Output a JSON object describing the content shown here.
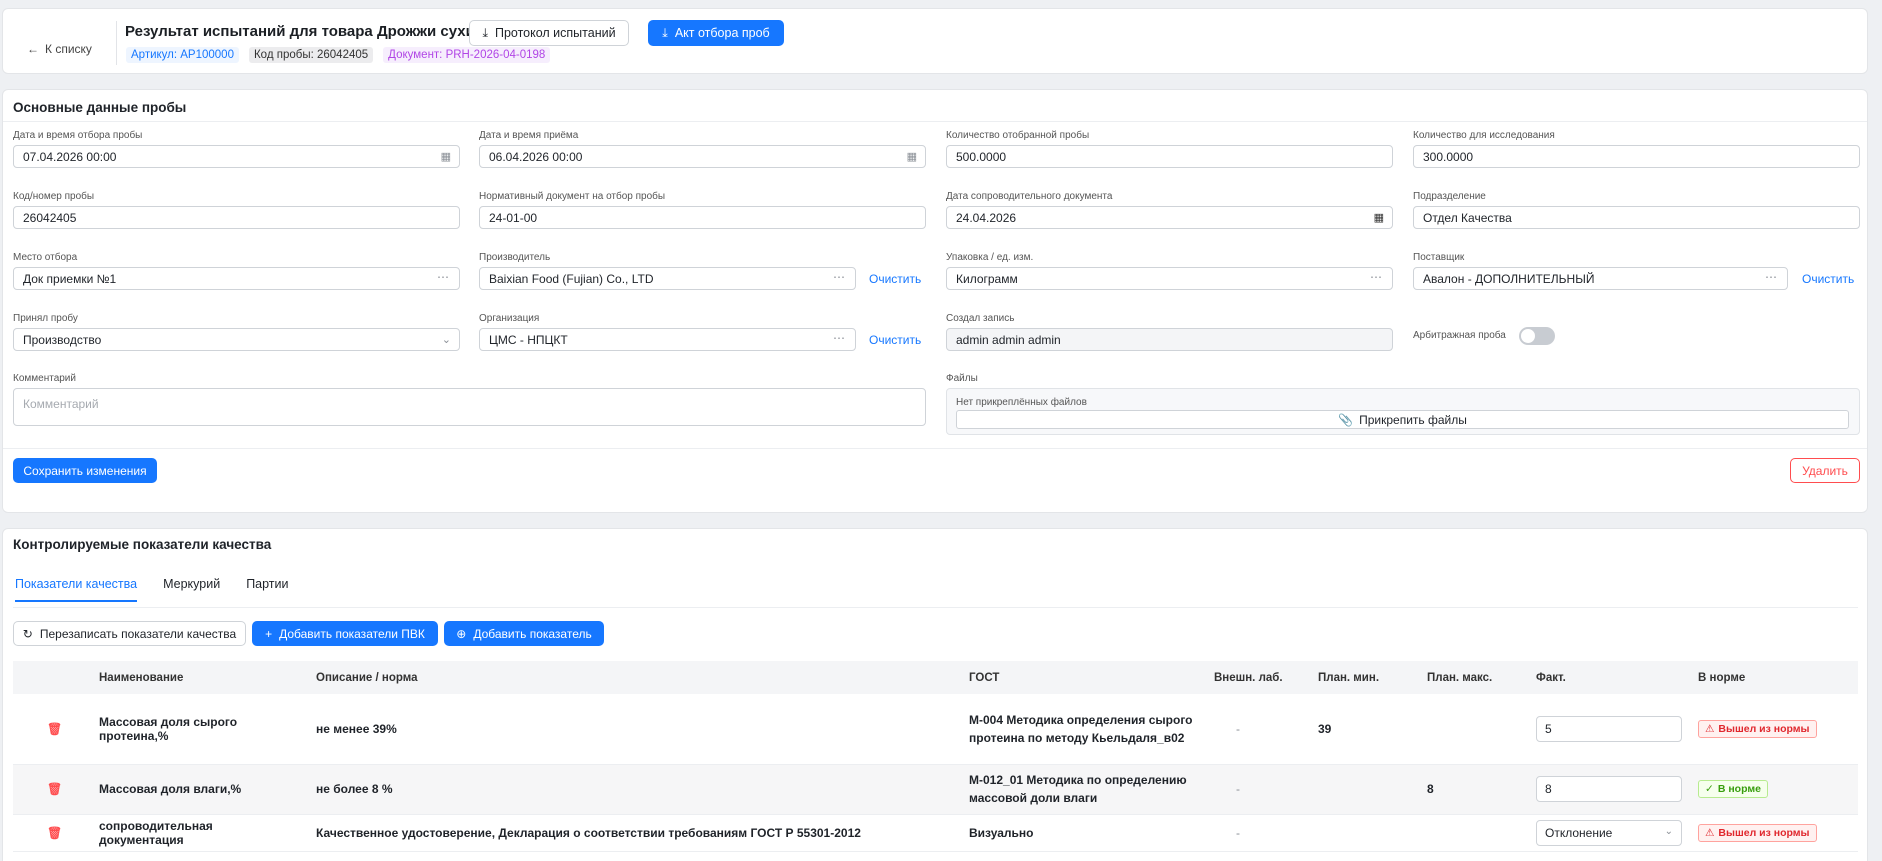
{
  "header": {
    "back_label": "К списку",
    "title": "Результат испытаний для товара Дрожжи сухие",
    "protocol_button": "Протокол испытаний",
    "act_button": "Акт отбора проб",
    "tag_article": "Артикул: АР100000",
    "tag_sample": "Код пробы: 26042405",
    "tag_document": "Документ: PRH-2026-04-0198"
  },
  "main": {
    "section_title": "Основные данные пробы",
    "fields": {
      "sample_date": {
        "label": "Дата и время отбора пробы",
        "value": "07.04.2026 00:00"
      },
      "receipt_date": {
        "label": "Дата и время приёма",
        "value": "06.04.2026 00:00"
      },
      "sample_qty": {
        "label": "Количество отобранной пробы",
        "value": "500.0000"
      },
      "research_qty": {
        "label": "Количество для исследования",
        "value": "300.0000"
      },
      "sample_code": {
        "label": "Код/номер пробы",
        "value": "26042405"
      },
      "norm_doc": {
        "label": "Нормативный документ на отбор пробы",
        "value": "24-01-00"
      },
      "accomp_date": {
        "label": "Дата сопроводительного документа",
        "value": "24.04.2026"
      },
      "department": {
        "label": "Подразделение",
        "value": "Отдел Качества"
      },
      "sample_place": {
        "label": "Место отбора",
        "value": "Док приемки №1"
      },
      "producer": {
        "label": "Производитель",
        "value": "Baixian Food (Fujian) Co., LTD"
      },
      "package": {
        "label": "Упаковка / ед. изм.",
        "value": "Килограмм"
      },
      "supplier": {
        "label": "Поставщик",
        "value": "Авалон - ДОПОЛНИТЕЛЬНЫЙ"
      },
      "accepted_by": {
        "label": "Принял пробу",
        "value": "Производство"
      },
      "organization": {
        "label": "Организация",
        "value": "ЦМС - НПЦКТ"
      },
      "created_by": {
        "label": "Создал запись",
        "value": "admin admin admin"
      },
      "arbitration": {
        "label": "Арбитражная проба",
        "value": "off"
      },
      "comment": {
        "label": "Комментарий",
        "placeholder": "Комментарий"
      },
      "files": {
        "label": "Файлы",
        "empty": "Нет прикреплённых файлов",
        "attach": "Прикрепить файлы"
      }
    },
    "clear_label": "Очистить",
    "save_button": "Сохранить изменения",
    "delete_button": "Удалить"
  },
  "quality": {
    "section_title": "Контролируемые показатели качества",
    "tabs": [
      "Показатели качества",
      "Меркурий",
      "Партии"
    ],
    "rewrite_button": "Перезаписать показатели качества",
    "add_pvk_button": "Добавить показатели ПВК",
    "add_indicator_button": "Добавить показатель",
    "columns": [
      "Наименование",
      "Описание / норма",
      "ГОСТ",
      "Внешн. лаб.",
      "План. мин.",
      "План. макс.",
      "Факт.",
      "В норме"
    ],
    "rows": [
      {
        "name": "Массовая доля сырого протеина,%",
        "norm": "не менее 39%",
        "gost": "М-004 Методика определения сырого протеина по методу Кьельдаля_в02",
        "ext": "-",
        "min": "39",
        "max": "",
        "fact": "5",
        "status": "Вышел из нормы"
      },
      {
        "name": "Массовая доля влаги,%",
        "norm": "не более 8 %",
        "gost": "М-012_01 Методика по определению массовой доли влаги",
        "ext": "-",
        "min": "",
        "max": "8",
        "fact": "8",
        "status": "В норме"
      },
      {
        "name": "сопроводительная документация",
        "norm": "Качественное удостоверение, Декларация о соответствии требованиям ГОСТ Р 55301-2012",
        "gost": "Визуально",
        "ext": "-",
        "min": "",
        "max": "",
        "fact": "Отклонение",
        "status": "Вышел из нормы"
      }
    ]
  },
  "colors": {
    "accent": "#1677ff",
    "danger": "#ff4d4f",
    "success": "#389e0d",
    "purple": "#b146e6"
  }
}
